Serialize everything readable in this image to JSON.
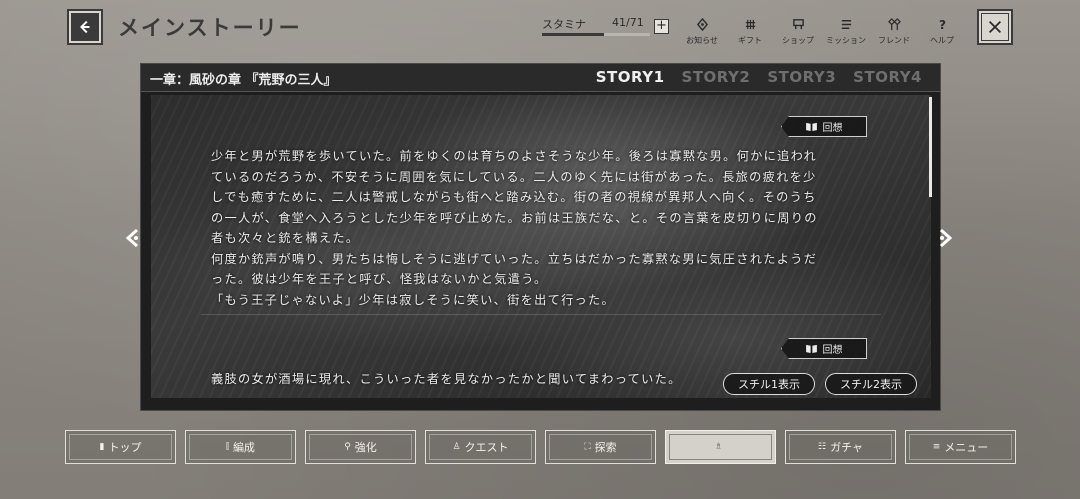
{
  "header": {
    "title": "メインストーリー",
    "stamina": {
      "label": "スタミナ",
      "value": "41/71",
      "fraction": 0.577,
      "plus": "+"
    },
    "nav": [
      {
        "label": "お知らせ",
        "icon": "notice-icon"
      },
      {
        "label": "ギフト",
        "icon": "gift-icon"
      },
      {
        "label": "ショップ",
        "icon": "shop-icon"
      },
      {
        "label": "ミッション",
        "icon": "mission-icon"
      },
      {
        "label": "フレンド",
        "icon": "friend-icon"
      },
      {
        "label": "ヘルプ",
        "icon": "help-icon"
      }
    ]
  },
  "panel": {
    "chapter": "一章：風砂の章 『荒野の三人』",
    "tabs": [
      "STORY1",
      "STORY2",
      "STORY3",
      "STORY4"
    ],
    "active_tab": 0,
    "recall_label": "回想",
    "story_text": "少年と男が荒野を歩いていた。前をゆくのは育ちのよさそうな少年。後ろは寡黙な男。何かに追われ\nているのだろうか、不安そうに周囲を気にしている。二人のゆく先には街があった。長旅の疲れを少\nしでも癒すために、二人は警戒しながらも街へと踏み込む。街の者の視線が異邦人へ向く。そのうち\nの一人が、食堂へ入ろうとした少年を呼び止めた。お前は王族だな、と。その言葉を皮切りに周りの\n者も次々と銃を構えた。\n何度か銃声が鳴り、男たちは悔しそうに逃げていった。立ちはだかった寡黙な男に気圧されたようだ\nった。彼は少年を王子と呼び、怪我はないかと気遣う。\n「もう王子じゃないよ」少年は寂しそうに笑い、街を出て行った。",
    "story_text2": "義肢の女が酒場に現れ、こういった者を見なかったかと聞いてまわっていた。",
    "still1": "スチル1表示",
    "still2": "スチル2表示"
  },
  "bottom_nav": [
    {
      "label": "トップ",
      "icon": "top-icon"
    },
    {
      "label": "編成",
      "icon": "formation-icon"
    },
    {
      "label": "強化",
      "icon": "enhance-icon"
    },
    {
      "label": "クエスト",
      "icon": "quest-icon"
    },
    {
      "label": "探索",
      "icon": "explore-icon"
    },
    {
      "label": "",
      "icon": "archive-icon",
      "active": true
    },
    {
      "label": "ガチャ",
      "icon": "gacha-icon"
    },
    {
      "label": "メニュー",
      "icon": "menu-icon"
    }
  ]
}
